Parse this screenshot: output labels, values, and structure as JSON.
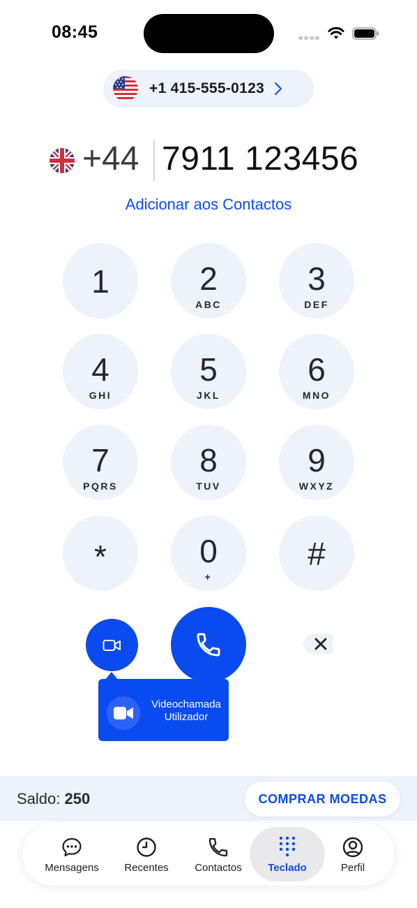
{
  "status_bar": {
    "time": "08:45"
  },
  "caller_id": {
    "country": "US",
    "number": "+1 415-555-0123"
  },
  "dialer": {
    "country": "UK",
    "country_code": "+44",
    "number": "7911 123456",
    "add_contact_label": "Adicionar aos Contactos"
  },
  "keypad": {
    "keys": [
      {
        "digit": "1",
        "letters": ""
      },
      {
        "digit": "2",
        "letters": "ABC"
      },
      {
        "digit": "3",
        "letters": "DEF"
      },
      {
        "digit": "4",
        "letters": "GHI"
      },
      {
        "digit": "5",
        "letters": "JKL"
      },
      {
        "digit": "6",
        "letters": "MNO"
      },
      {
        "digit": "7",
        "letters": "PQRS"
      },
      {
        "digit": "8",
        "letters": "TUV"
      },
      {
        "digit": "9",
        "letters": "WXYZ"
      },
      {
        "digit": "*",
        "letters": ""
      },
      {
        "digit": "0",
        "letters": "+"
      },
      {
        "digit": "#",
        "letters": ""
      }
    ]
  },
  "tooltip": {
    "line1": "Videochamada",
    "line2": "Utilizador"
  },
  "balance": {
    "label": "Saldo:",
    "value": "250",
    "buy_label": "COMPRAR MOEDAS"
  },
  "tabs": [
    {
      "label": "Mensagens",
      "icon": "message-icon",
      "active": false
    },
    {
      "label": "Recentes",
      "icon": "clock-icon",
      "active": false
    },
    {
      "label": "Contactos",
      "icon": "phone-icon",
      "active": false
    },
    {
      "label": "Teclado",
      "icon": "keypad-icon",
      "active": true
    },
    {
      "label": "Perfil",
      "icon": "profile-icon",
      "active": false
    }
  ],
  "colors": {
    "accent": "#0a4bf0",
    "key_bg": "#edf2fb",
    "text": "#1c1c22"
  }
}
